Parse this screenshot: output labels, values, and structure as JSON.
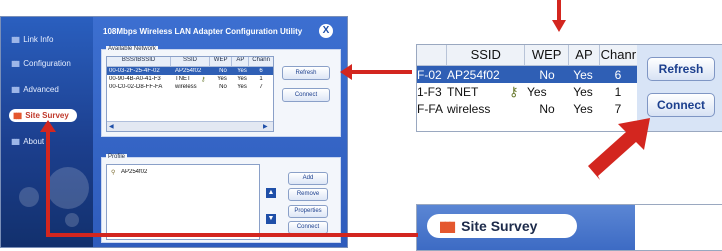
{
  "window": {
    "title": "108Mbps Wireless LAN Adapter Configuration Utility",
    "close_label": "X"
  },
  "sidebar": {
    "items": [
      {
        "label": "Link Info",
        "active": false
      },
      {
        "label": "Configuration",
        "active": false
      },
      {
        "label": "Advanced",
        "active": false
      },
      {
        "label": "Site Survey",
        "active": true
      },
      {
        "label": "About",
        "active": false
      }
    ]
  },
  "available_network": {
    "group_label": "Available Network",
    "columns": [
      "BSS/IBSSID",
      "SSID",
      "WEP",
      "AP",
      "Chann"
    ],
    "rows": [
      {
        "bssid": "00-03-2F-25-4F-02",
        "ssid": "AP254f02",
        "wep": "No",
        "ap": "Yes",
        "chan": "6",
        "selected": true,
        "icon": ""
      },
      {
        "bssid": "00-90-4B-A0-41-F3",
        "ssid": "TNET",
        "wep": "Yes",
        "ap": "Yes",
        "chan": "1",
        "selected": false,
        "icon": "key-icon"
      },
      {
        "bssid": "00-C0-02-D8-FF-FA",
        "ssid": "wireless",
        "wep": "No",
        "ap": "Yes",
        "chan": "7",
        "selected": false,
        "icon": ""
      }
    ],
    "refresh_label": "Refresh",
    "connect_label": "Connect"
  },
  "profile": {
    "group_label": "Profile",
    "items": [
      "AP254f02"
    ],
    "add_label": "Add",
    "remove_label": "Remove",
    "properties_label": "Properties",
    "connect_label": "Connect"
  },
  "zoom_table": {
    "columns": [
      "SSID",
      "WEP",
      "AP",
      "Chanr"
    ],
    "rows": [
      {
        "prefix": "F-02",
        "ssid": "AP254f02",
        "wep": "No",
        "ap": "Yes",
        "chan": "6",
        "selected": true
      },
      {
        "prefix": "1-F3",
        "ssid": "TNET",
        "wep": "Yes",
        "ap": "Yes",
        "chan": "1",
        "selected": false
      },
      {
        "prefix": "F-FA",
        "ssid": "wireless",
        "wep": "No",
        "ap": "Yes",
        "chan": "7",
        "selected": false
      }
    ],
    "refresh_label": "Refresh",
    "connect_label": "Connect"
  },
  "zoom_site_survey": {
    "label": "Site Survey"
  },
  "colors": {
    "annotation_red": "#d3261f",
    "selection_blue": "#2f5fb5",
    "panel_blue": "#1f4fa8"
  }
}
